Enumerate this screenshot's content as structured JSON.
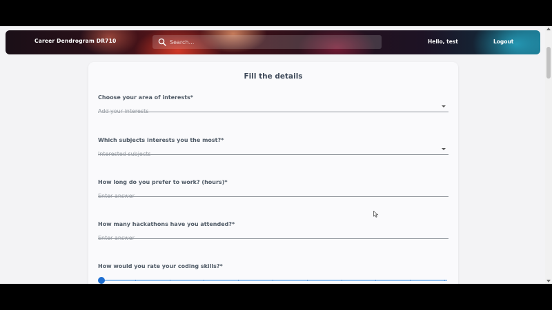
{
  "app": {
    "brand": "Career Dendrogram DR710"
  },
  "header": {
    "search_placeholder": "Search…",
    "greeting": "Hello, test",
    "logout_label": "Logout"
  },
  "form": {
    "title": "Fill the details",
    "fields": [
      {
        "label": "Choose your area of interests*",
        "placeholder": "Add your interests",
        "type": "select"
      },
      {
        "label": "Which subjects interests you the most?*",
        "placeholder": "Interested subjects",
        "type": "select"
      },
      {
        "label": "How long do you prefer to work? (hours)*",
        "placeholder": "Enter answer",
        "type": "text"
      },
      {
        "label": "How many hackathons have you attended?*",
        "placeholder": "Enter answer",
        "type": "text"
      },
      {
        "label": "How would you rate your coding skills?*",
        "type": "slider"
      }
    ],
    "coding_skill_slider": {
      "value_fraction": 0.0,
      "tick_count": 10
    }
  },
  "colors": {
    "accent": "#1f6fd1",
    "slider_track": "#90bff0",
    "page_bg": "#f3f3f5"
  },
  "icons": {
    "search": "search-icon",
    "dropdown": "chevron-down-icon"
  }
}
